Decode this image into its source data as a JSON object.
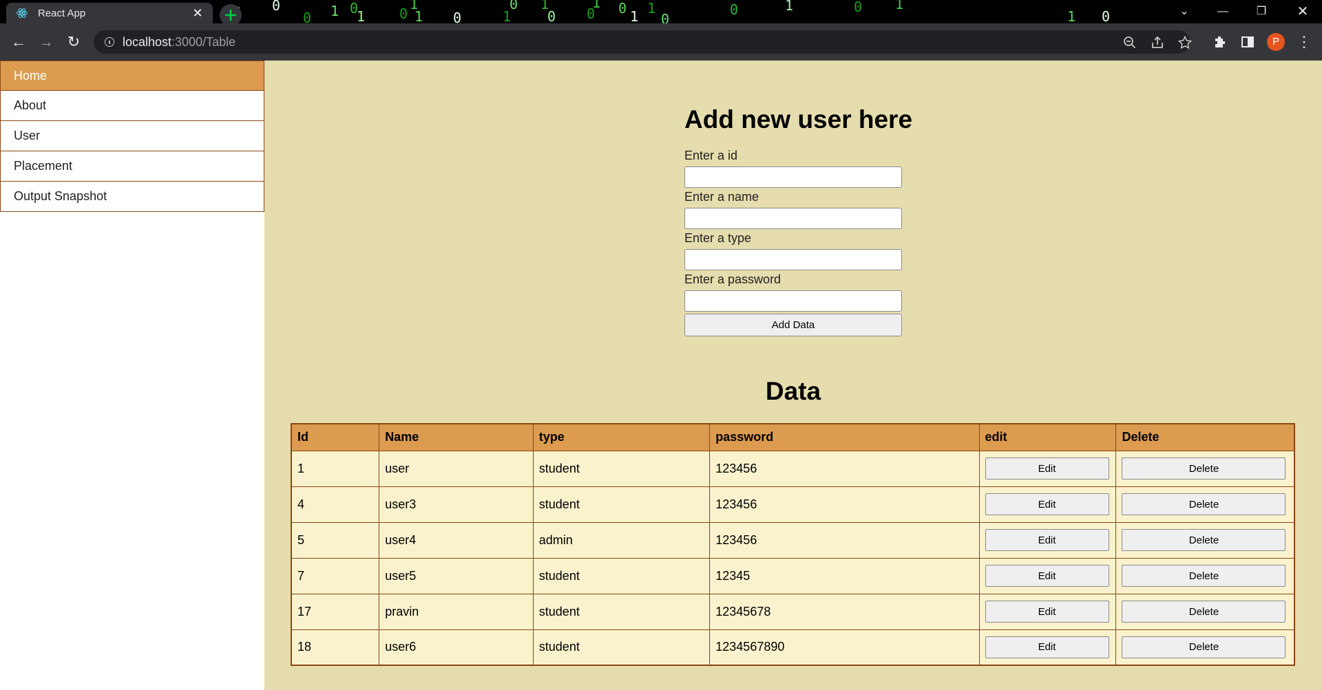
{
  "browser": {
    "tab_title": "React App",
    "url_host": "localhost",
    "url_path": ":3000/Table",
    "profile_initial": "P",
    "matrix_digits": [
      "1",
      "0",
      "0",
      "1",
      "0",
      "1",
      "0",
      "1",
      "1",
      "0",
      "1",
      "0",
      "1",
      "0",
      "0",
      "1",
      "0",
      "1",
      "1",
      "0",
      "0",
      "1",
      "0",
      "1",
      "1",
      "0"
    ]
  },
  "sidebar": {
    "items": [
      {
        "label": "Home",
        "active": true
      },
      {
        "label": "About"
      },
      {
        "label": "User"
      },
      {
        "label": "Placement"
      },
      {
        "label": "Output Snapshot"
      }
    ]
  },
  "form": {
    "title": "Add new user here",
    "fields": [
      {
        "label": "Enter a id",
        "value": ""
      },
      {
        "label": "Enter a name",
        "value": ""
      },
      {
        "label": "Enter a type",
        "value": ""
      },
      {
        "label": "Enter a password",
        "value": ""
      }
    ],
    "submit_label": "Add Data"
  },
  "data_section": {
    "title": "Data",
    "columns": [
      "Id",
      "Name",
      "type",
      "password",
      "edit",
      "Delete"
    ],
    "rows": [
      {
        "id": "1",
        "name": "user",
        "type": "student",
        "password": "123456"
      },
      {
        "id": "4",
        "name": "user3",
        "type": "student",
        "password": "123456"
      },
      {
        "id": "5",
        "name": "user4",
        "type": "admin",
        "password": "123456"
      },
      {
        "id": "7",
        "name": "user5",
        "type": "student",
        "password": "12345"
      },
      {
        "id": "17",
        "name": "pravin",
        "type": "student",
        "password": "12345678"
      },
      {
        "id": "18",
        "name": "user6",
        "type": "student",
        "password": "1234567890"
      }
    ],
    "edit_label": "Edit",
    "delete_label": "Delete"
  },
  "colors": {
    "accent": "#dc9b4f",
    "border": "#8b4513",
    "main_bg": "#e5ddad",
    "cell_bg": "#faf2cd"
  }
}
